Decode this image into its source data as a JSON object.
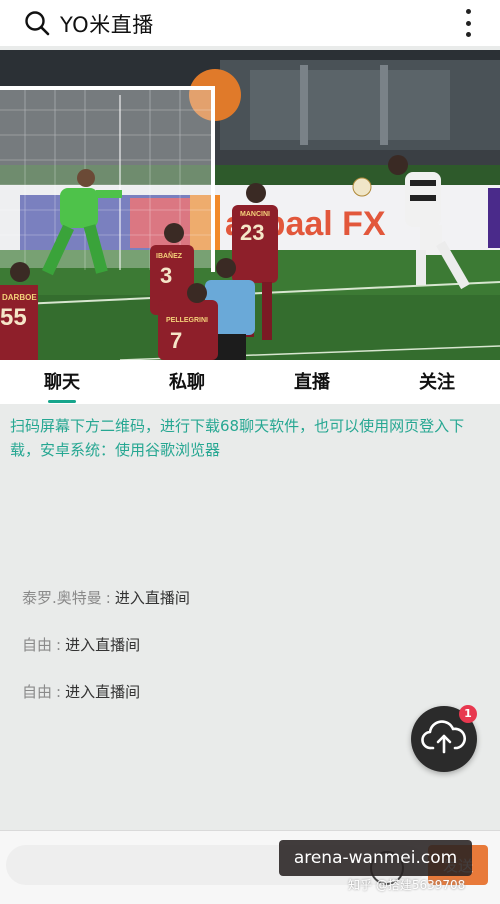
{
  "header": {
    "title": "YO米直播"
  },
  "video": {
    "players": [
      {
        "number": "55",
        "name": "DARBOE"
      },
      {
        "number": "3",
        "name": "IBAÑEZ"
      },
      {
        "number": "23",
        "name": "MANCINI"
      },
      {
        "number": "7",
        "name": "PELLEGRINI"
      }
    ],
    "board_text": "aupaal FX"
  },
  "tabs": [
    {
      "label": "聊天",
      "active": true
    },
    {
      "label": "私聊",
      "active": false
    },
    {
      "label": "直播",
      "active": false
    },
    {
      "label": "关注",
      "active": false
    }
  ],
  "notice": "扫码屏幕下方二维码，进行下载68聊天软件，也可以使用网页登入下载，安卓系统：使用谷歌浏览器",
  "messages": [
    {
      "user": "泰罗.奥特曼",
      "text": "进入直播间"
    },
    {
      "user": "自由",
      "text": "进入直播间"
    },
    {
      "user": "自由",
      "text": "进入直播间"
    }
  ],
  "fab": {
    "icon": "cloud-upload-icon",
    "badge": "1"
  },
  "input": {
    "value": "",
    "placeholder": ""
  },
  "send_label": "发送",
  "watermark": {
    "main": "arena-wanmei.com",
    "small": "知乎 @搭建5639708"
  },
  "colors": {
    "accent": "#16a58c",
    "notice_text": "#26a792",
    "fab_bg": "#2b2b2b",
    "badge": "#e8384f",
    "send_button": "#e87a3a"
  }
}
